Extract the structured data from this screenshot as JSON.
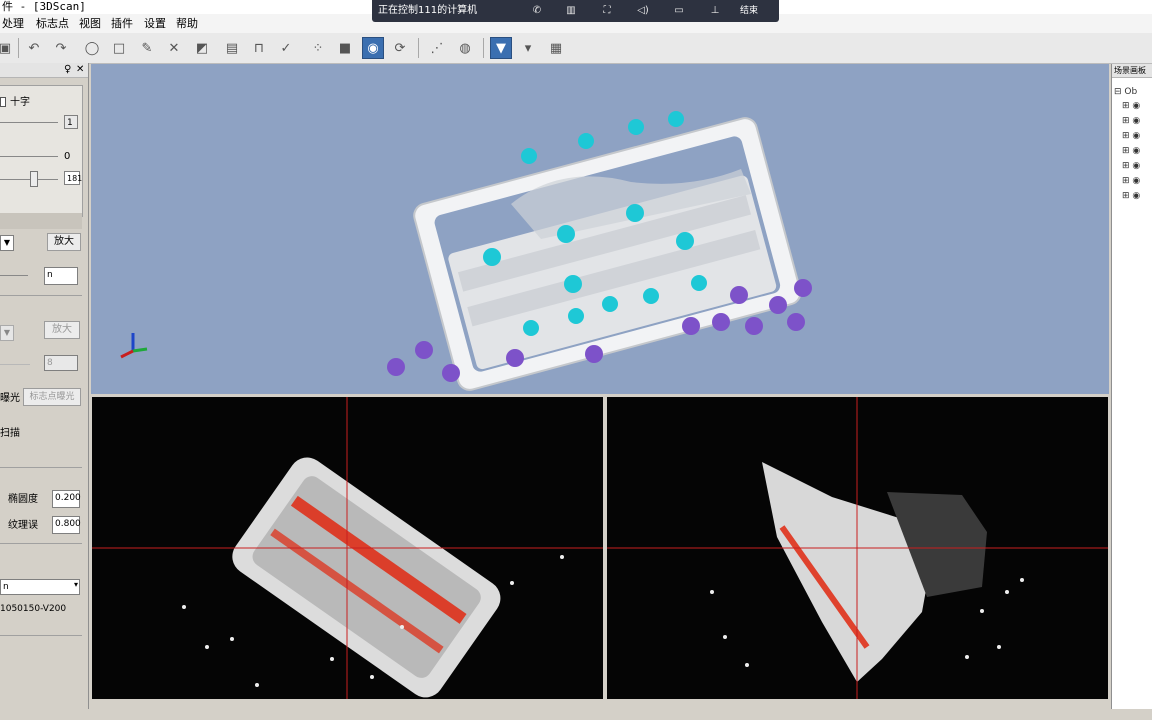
{
  "title_bar": {
    "text": "件 - [3DScan]"
  },
  "menu": {
    "items": [
      "处理",
      "标志点",
      "视图",
      "插件",
      "设置",
      "帮助"
    ]
  },
  "remote_bar": {
    "text": "正在控制111的计算机",
    "exit_label": "结束"
  },
  "toolbar": {
    "icons": [
      "save-icon",
      "undo-icon",
      "redo-icon",
      "lasso-icon",
      "rect-select-icon",
      "brush-icon",
      "delete-icon",
      "invert-icon",
      "scanner-icon",
      "tripod-icon",
      "clean-icon",
      "points-icon",
      "box-icon",
      "eye-icon",
      "refresh-icon",
      "network-icon",
      "globe-icon",
      "camera-icon",
      "camera2-icon",
      "grid-icon"
    ]
  },
  "left_panel": {
    "checkbox_label": "十字",
    "slider1_value": "1",
    "slider2_value": "0",
    "slider3_value": "181",
    "zoom_button": "放大",
    "zoom_input": "n",
    "zoom_button2": "放大",
    "disabled_value": "8",
    "exposure_label": "曝光",
    "marker_exposure_button": "标志点曝光",
    "scan_label": "扫描",
    "ellipse_label": "椭圆度",
    "ellipse_value": "0.200",
    "texture_label": "纹理误",
    "texture_value": "0.800",
    "select_value": "n",
    "device_text": "1050150-V200"
  },
  "right_panel": {
    "header": "场景画板",
    "root": "Ob",
    "items": [
      "",
      "",
      "",
      "",
      "",
      "",
      ""
    ]
  },
  "colors": {
    "viewport_bg": "#8ea2c3",
    "marker_cyan": "#1ec8d6",
    "marker_purple": "#7d52c9",
    "crosshair": "#c81e1e",
    "highlight": "#e12810"
  }
}
